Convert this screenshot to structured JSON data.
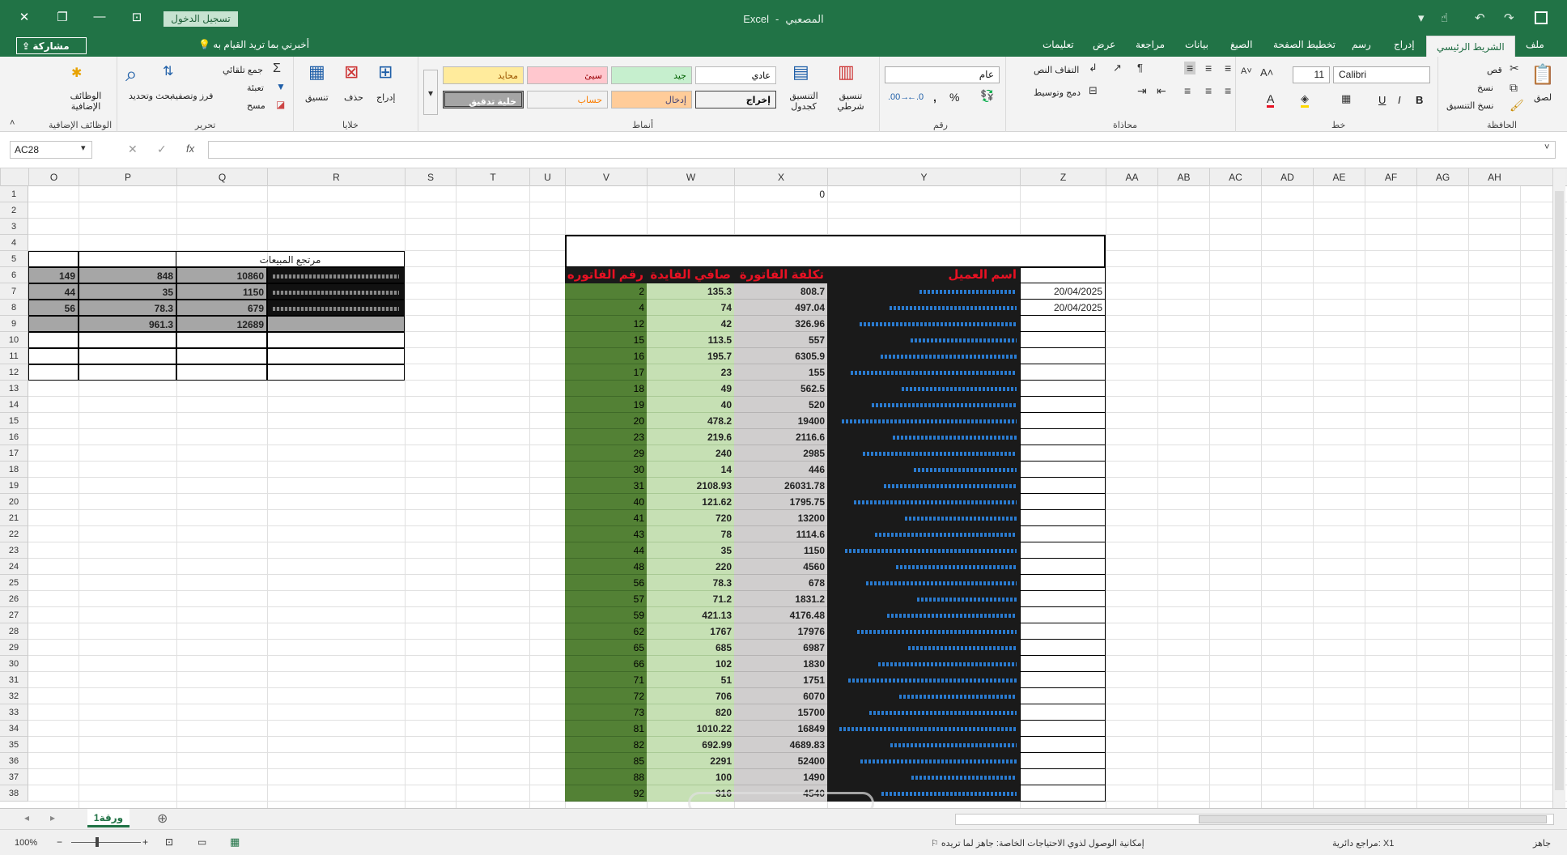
{
  "app": {
    "name": "Excel",
    "file": "المصعبي",
    "separator": "-"
  },
  "titlebar": {
    "login_button": "تسجيل الدخول",
    "close": "✕",
    "restore": "❐",
    "minimize": "—",
    "ribbon_display": "⊡",
    "save_icon": "save-icon"
  },
  "tabs": [
    {
      "label": "ملف"
    },
    {
      "label": "الشريط الرئيسي",
      "active": true
    },
    {
      "label": "إدراج"
    },
    {
      "label": "رسم"
    },
    {
      "label": "تخطيط الصفحة"
    },
    {
      "label": "الصيغ"
    },
    {
      "label": "بيانات"
    },
    {
      "label": "مراجعة"
    },
    {
      "label": "عرض"
    },
    {
      "label": "تعليمات"
    }
  ],
  "tell_me": "أخبرني بما تريد القيام به",
  "share": "مشاركة",
  "ribbon": {
    "clipboard": {
      "label": "الحافظة",
      "paste": "لصق",
      "cut": "قص",
      "copy": "نسخ",
      "format_painter": "نسخ التنسيق"
    },
    "font": {
      "label": "خط",
      "name": "Calibri",
      "size": "11",
      "bold": "B",
      "italic": "I",
      "underline": "U"
    },
    "alignment": {
      "label": "محاذاة",
      "wrap": "التفاف النص",
      "merge": "دمج وتوسيط"
    },
    "number": {
      "label": "رقم",
      "format": "عام",
      "percent": "%",
      "comma": ","
    },
    "styles": {
      "label": "أنماط",
      "conditional": "تنسيق شرطي",
      "as_table": "التنسيق كجدول",
      "normal": "عادي",
      "good": "جيد",
      "bad": "سيئ",
      "neutral": "محايد",
      "output": "إخراج",
      "input": "إدخال",
      "calculation": "حساب",
      "check_cell": "خلية تدقيق"
    },
    "cells": {
      "label": "خلايا",
      "insert": "إدراج",
      "delete": "حذف",
      "format": "تنسيق"
    },
    "editing": {
      "label": "تحرير",
      "autosum": "جمع تلقائي",
      "fill": "تعبئة",
      "clear": "مسح",
      "sort": "فرز وتصفية",
      "find": "بحث وتحديد"
    },
    "addins": {
      "label": "الوظائف الإضافية",
      "button": "الوظائف الإضافية"
    }
  },
  "formula_bar": {
    "name_box": "AC28",
    "cancel": "✕",
    "enter": "✓",
    "fx": "fx",
    "value": ""
  },
  "columns": [
    "O",
    "P",
    "Q",
    "R",
    "S",
    "T",
    "U",
    "V",
    "W",
    "X",
    "Y",
    "Z",
    "AA",
    "AB",
    "AC",
    "AD",
    "AE",
    "AF",
    "AG",
    "AH"
  ],
  "rows": [
    "1",
    "2",
    "3",
    "4",
    "5",
    "6",
    "7",
    "8",
    "9",
    "10",
    "11",
    "12",
    "13",
    "14",
    "15",
    "16",
    "17",
    "18",
    "19",
    "20",
    "21",
    "22",
    "23",
    "24",
    "25",
    "26",
    "27",
    "28",
    "29",
    "30",
    "31",
    "32",
    "33",
    "34",
    "35",
    "36",
    "37",
    "38"
  ],
  "sheet": {
    "x1": "0",
    "sales_title": "مرتجع المبيعات",
    "left_table": [
      {
        "o": "149",
        "p": "848",
        "q": "10860"
      },
      {
        "o": "44",
        "p": "35",
        "q": "1150"
      },
      {
        "o": "56",
        "p": "78.3",
        "q": "679"
      }
    ],
    "left_totals": {
      "p": "961.3",
      "q": "12689"
    },
    "headers": {
      "v": "رقم الفاتوره",
      "w": "صافي الفايدة",
      "x": "تكلفة الفاتورة",
      "y": "اسم العميل"
    },
    "dates": [
      "20/04/2025",
      "20/04/2025"
    ],
    "rows": [
      [
        "2",
        "135.3",
        "808.7"
      ],
      [
        "4",
        "74",
        "497.04"
      ],
      [
        "12",
        "42",
        "326.96"
      ],
      [
        "15",
        "113.5",
        "557"
      ],
      [
        "16",
        "195.7",
        "6305.9"
      ],
      [
        "17",
        "23",
        "155"
      ],
      [
        "18",
        "49",
        "562.5"
      ],
      [
        "19",
        "40",
        "520"
      ],
      [
        "20",
        "478.2",
        "19400"
      ],
      [
        "23",
        "219.6",
        "2116.6"
      ],
      [
        "29",
        "240",
        "2985"
      ],
      [
        "30",
        "14",
        "446"
      ],
      [
        "31",
        "2108.93",
        "26031.78"
      ],
      [
        "40",
        "121.62",
        "1795.75"
      ],
      [
        "41",
        "720",
        "13200"
      ],
      [
        "43",
        "78",
        "1114.6"
      ],
      [
        "44",
        "35",
        "1150"
      ],
      [
        "48",
        "220",
        "4560"
      ],
      [
        "56",
        "78.3",
        "678"
      ],
      [
        "57",
        "71.2",
        "1831.2"
      ],
      [
        "59",
        "421.13",
        "4176.48"
      ],
      [
        "62",
        "1767",
        "17976"
      ],
      [
        "65",
        "685",
        "6987"
      ],
      [
        "66",
        "102",
        "1830"
      ],
      [
        "71",
        "51",
        "1751"
      ],
      [
        "72",
        "706",
        "6070"
      ],
      [
        "73",
        "820",
        "15700"
      ],
      [
        "81",
        "1010.22",
        "16849"
      ],
      [
        "82",
        "692.99",
        "4689.83"
      ],
      [
        "85",
        "2291",
        "52400"
      ],
      [
        "88",
        "100",
        "1490"
      ],
      [
        "92",
        "316",
        "4540"
      ]
    ]
  },
  "sheet_tab": "ورقة1",
  "status": {
    "ready": "جاهز",
    "circular": "مراجع دائرية: X1",
    "accessibility": "إمكانية الوصول لذوي الاحتياجات الخاصة: جاهز لما تريده",
    "zoom": "100%"
  },
  "colors": {
    "excel_green": "#217346",
    "header_dark": "#1a1a1a",
    "v_green": "#538135",
    "w_green": "#c6e0b4",
    "x_gray": "#d0cece",
    "red_text": "#e81123"
  }
}
